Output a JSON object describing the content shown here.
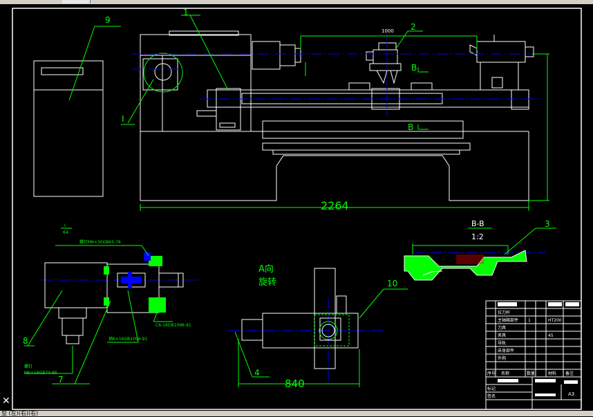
{
  "colors": {
    "bg": "#000000",
    "white": "#ffffff",
    "green": "#00ff00",
    "blue": "#0000ff",
    "yellow": "#ffff00",
    "cyan": "#00ffff",
    "red": "#ff0000",
    "magenta": "#ff00ff"
  },
  "labels": {
    "p1": "1",
    "p2": "2",
    "p3": "3",
    "p4": "4",
    "p7": "7",
    "p8": "8",
    "p9": "9",
    "p10": "10",
    "detail_I": "I",
    "detail_I_scale": "I",
    "detail_I_ratio": "64",
    "bb_top": "B",
    "bb_bottom": "B",
    "section_title": "B-B",
    "section_scale": "1:2",
    "dim_1000": "1000",
    "dim_2264": "2264",
    "dim_840": "840",
    "a_dir_1": "A向",
    "a_dir_2": "旋转",
    "note_screw": "螺钉M6×30GB65-76",
    "note_screw2": "螺钉",
    "note_screw2_spec": "M6×16GB70-85",
    "note_pin1": "销6×16GB1096-91",
    "note_pin2": "C6-16GB1096-91"
  },
  "title_block": {
    "rows": [
      "1",
      "2",
      "3",
      "4",
      "5",
      "6",
      "7",
      "8",
      "9",
      "10"
    ],
    "cols": [
      "序号",
      "名称",
      "数量",
      "材料",
      "备注"
    ],
    "cells": [
      "拉刀杆",
      "主轴箱部件",
      "1",
      "HT200",
      "",
      "刀具",
      "1",
      "20",
      "",
      "夹具",
      "1",
      "45",
      "",
      "导轨",
      "1",
      "HT200",
      "",
      "床身部件",
      "1",
      "",
      "外购"
    ],
    "sig_labels": [
      "标记",
      "处数",
      "分区",
      "更改文件号",
      "签名",
      "年月日"
    ],
    "proj": "A3"
  },
  "statusbar": {
    "text": "型  (左)(右)(右)"
  }
}
